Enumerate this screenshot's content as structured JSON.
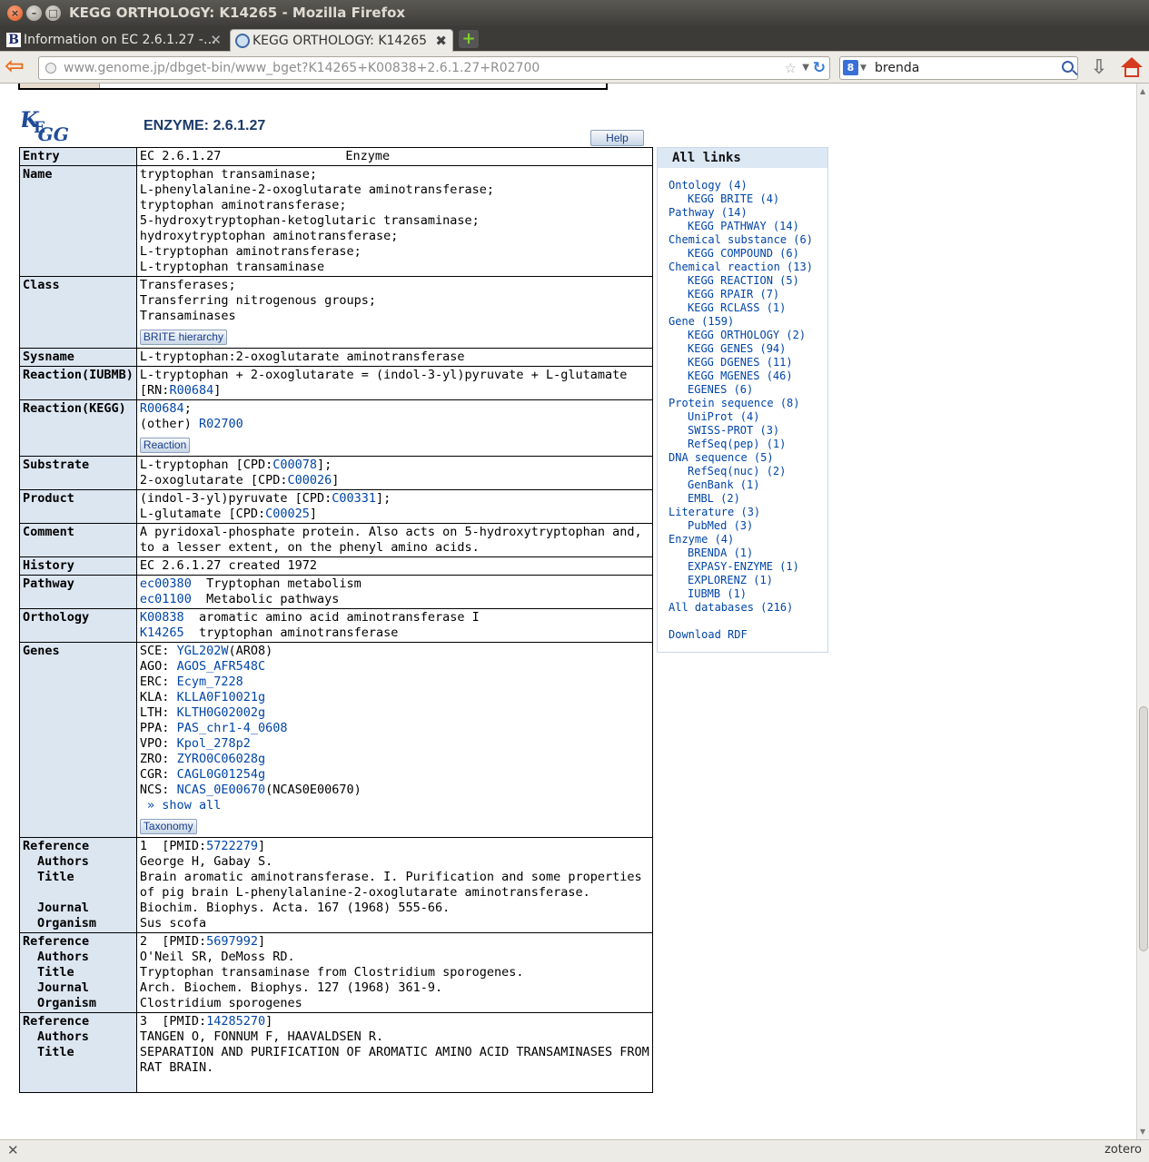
{
  "window": {
    "title": "KEGG ORTHOLOGY: K14265 - Mozilla Firefox"
  },
  "tabs": [
    {
      "label": "Information on EC 2.6.1.27 -…"
    },
    {
      "label": "KEGG ORTHOLOGY: K14265"
    }
  ],
  "nav": {
    "url": "www.genome.jp/dbget-bin/www_bget?K14265+K00838+2.6.1.27+R02700",
    "search_value": "brenda",
    "search_engine_icon": "8"
  },
  "page": {
    "header": "ENZYME: 2.6.1.27",
    "help_label": "Help",
    "logo_text": "KEGG",
    "rows": {
      "entry": {
        "label": "Entry",
        "id": "EC 2.6.1.27",
        "type": "Enzyme"
      },
      "name": {
        "label": "Name",
        "lines": [
          "tryptophan transaminase;",
          "L-phenylalanine-2-oxoglutarate aminotransferase;",
          "tryptophan aminotransferase;",
          "5-hydroxytryptophan-ketoglutaric transaminase;",
          "hydroxytryptophan aminotransferase;",
          "L-tryptophan aminotransferase;",
          "L-tryptophan transaminase"
        ]
      },
      "class": {
        "label": "Class",
        "lines": [
          "Transferases;",
          "Transferring nitrogenous groups;",
          "Transaminases"
        ],
        "button": "BRITE hierarchy"
      },
      "sysname": {
        "label": "Sysname",
        "value": "L-tryptophan:2-oxoglutarate aminotransferase"
      },
      "reaction_iubmb": {
        "label": "Reaction(IUBMB)",
        "line1": "L-tryptophan + 2-oxoglutarate = (indol-3-yl)pyruvate + L-glutamate",
        "rn_prefix": "[RN:",
        "rn_link": "R00684",
        "rn_suffix": "]"
      },
      "reaction_kegg": {
        "label": "Reaction(KEGG)",
        "link1": "R00684",
        "sep1": ";",
        "other_prefix": "(other) ",
        "link2": "R02700",
        "button": "Reaction"
      },
      "substrate": {
        "label": "Substrate",
        "l1_text": "L-tryptophan [CPD:",
        "l1_link": "C00078",
        "l1_end": "];",
        "l2_text": "2-oxoglutarate [CPD:",
        "l2_link": "C00026",
        "l2_end": "]"
      },
      "product": {
        "label": "Product",
        "l1_text": "(indol-3-yl)pyruvate [CPD:",
        "l1_link": "C00331",
        "l1_end": "];",
        "l2_text": "L-glutamate [CPD:",
        "l2_link": "C00025",
        "l2_end": "]"
      },
      "comment": {
        "label": "Comment",
        "lines": [
          "A pyridoxal-phosphate protein. Also acts on 5-hydroxytryptophan and,",
          "to a lesser extent, on the phenyl amino acids."
        ]
      },
      "history": {
        "label": "History",
        "value": "EC 2.6.1.27 created 1972"
      },
      "pathway": {
        "label": "Pathway",
        "items": [
          {
            "id": "ec00380",
            "name": "  Tryptophan metabolism"
          },
          {
            "id": "ec01100",
            "name": "  Metabolic pathways"
          }
        ]
      },
      "orthology": {
        "label": "Orthology",
        "items": [
          {
            "id": "K00838",
            "name": "  aromatic amino acid aminotransferase I"
          },
          {
            "id": "K14265",
            "name": "  tryptophan aminotransferase"
          }
        ]
      },
      "genes": {
        "label": "Genes",
        "items": [
          {
            "org": "SCE: ",
            "gene": "YGL202W",
            "extra": "(ARO8)"
          },
          {
            "org": "AGO: ",
            "gene": "AGOS_AFR548C",
            "extra": ""
          },
          {
            "org": "ERC: ",
            "gene": "Ecym_7228",
            "extra": ""
          },
          {
            "org": "KLA: ",
            "gene": "KLLA0F10021g",
            "extra": ""
          },
          {
            "org": "LTH: ",
            "gene": "KLTH0G02002g",
            "extra": ""
          },
          {
            "org": "PPA: ",
            "gene": "PAS_chr1-4_0608",
            "extra": ""
          },
          {
            "org": "VPO: ",
            "gene": "Kpol_278p2",
            "extra": ""
          },
          {
            "org": "ZRO: ",
            "gene": "ZYRO0C06028g",
            "extra": ""
          },
          {
            "org": "CGR: ",
            "gene": "CAGL0G01254g",
            "extra": ""
          },
          {
            "org": "NCS: ",
            "gene": "NCAS_0E00670",
            "extra": "(NCAS0E00670)"
          }
        ],
        "show_all": " » show all",
        "button": "Taxonomy"
      },
      "refs": [
        {
          "label": "Reference",
          "num": "1  [PMID:",
          "pmid": "5722279",
          "end": "]",
          "authors_label": "Authors",
          "authors": "George H, Gabay S.",
          "title_label": "Title",
          "title_lines": [
            "Brain aromatic aminotransferase. I. Purification and some properties",
            "of pig brain L-phenylalanine-2-oxoglutarate aminotransferase."
          ],
          "journal_label": "Journal",
          "journal": "Biochim. Biophys. Acta. 167 (1968) 555-66.",
          "organism_label": "Organism",
          "organism": "Sus scofa"
        },
        {
          "label": "Reference",
          "num": "2  [PMID:",
          "pmid": "5697992",
          "end": "]",
          "authors_label": "Authors",
          "authors": "O'Neil SR, DeMoss RD.",
          "title_label": "Title",
          "title_lines": [
            "Tryptophan transaminase from Clostridium sporogenes."
          ],
          "journal_label": "Journal",
          "journal": "Arch. Biochem. Biophys. 127 (1968) 361-9.",
          "organism_label": "Organism",
          "organism": "Clostridium sporogenes"
        },
        {
          "label": "Reference",
          "num": "3  [PMID:",
          "pmid": "14285270",
          "end": "]",
          "authors_label": "Authors",
          "authors": "TANGEN O, FONNUM F, HAAVALDSEN R.",
          "title_label": "Title",
          "title_lines": [
            "SEPARATION AND PURIFICATION OF AROMATIC AMINO ACID TRANSAMINASES FROM",
            "RAT BRAIN."
          ]
        }
      ]
    },
    "all_links": {
      "header": "All links",
      "items": [
        {
          "t": "Ontology (4)",
          "sub": false
        },
        {
          "t": "KEGG BRITE (4)",
          "sub": true
        },
        {
          "t": "Pathway (14)",
          "sub": false
        },
        {
          "t": "KEGG PATHWAY (14)",
          "sub": true
        },
        {
          "t": "Chemical substance (6)",
          "sub": false
        },
        {
          "t": "KEGG COMPOUND (6)",
          "sub": true
        },
        {
          "t": "Chemical reaction (13)",
          "sub": false
        },
        {
          "t": "KEGG REACTION (5)",
          "sub": true
        },
        {
          "t": "KEGG RPAIR (7)",
          "sub": true
        },
        {
          "t": "KEGG RCLASS (1)",
          "sub": true
        },
        {
          "t": "Gene (159)",
          "sub": false
        },
        {
          "t": "KEGG ORTHOLOGY (2)",
          "sub": true
        },
        {
          "t": "KEGG GENES (94)",
          "sub": true
        },
        {
          "t": "KEGG DGENES (11)",
          "sub": true
        },
        {
          "t": "KEGG MGENES (46)",
          "sub": true
        },
        {
          "t": "EGENES (6)",
          "sub": true
        },
        {
          "t": "Protein sequence (8)",
          "sub": false
        },
        {
          "t": "UniProt (4)",
          "sub": true
        },
        {
          "t": "SWISS-PROT (3)",
          "sub": true
        },
        {
          "t": "RefSeq(pep) (1)",
          "sub": true
        },
        {
          "t": "DNA sequence (5)",
          "sub": false
        },
        {
          "t": "RefSeq(nuc) (2)",
          "sub": true
        },
        {
          "t": "GenBank (1)",
          "sub": true
        },
        {
          "t": "EMBL (2)",
          "sub": true
        },
        {
          "t": "Literature (3)",
          "sub": false
        },
        {
          "t": "PubMed (3)",
          "sub": true
        },
        {
          "t": "Enzyme (4)",
          "sub": false
        },
        {
          "t": "BRENDA (1)",
          "sub": true
        },
        {
          "t": "EXPASY-ENZYME (1)",
          "sub": true
        },
        {
          "t": "EXPLORENZ (1)",
          "sub": true
        },
        {
          "t": "IUBMB (1)",
          "sub": true
        },
        {
          "t": "All databases (216)",
          "sub": false
        }
      ],
      "download": "Download RDF"
    }
  },
  "status": {
    "zotero": "zotero"
  },
  "colors": {
    "link": "#0045a8",
    "label_bg": "#dce6f1",
    "accent": "#e05a24"
  }
}
